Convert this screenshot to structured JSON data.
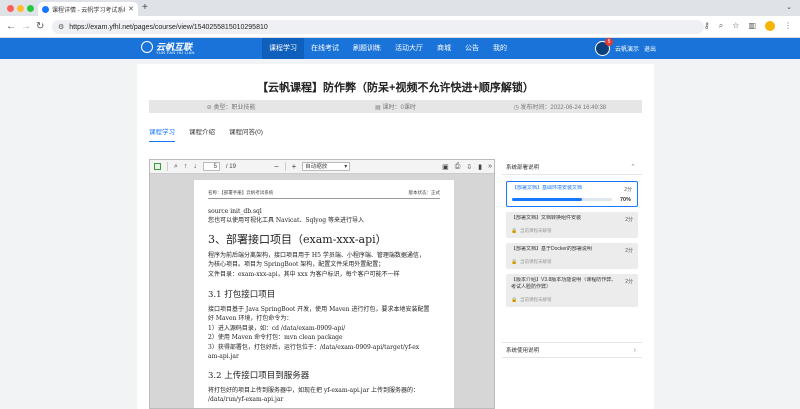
{
  "browser": {
    "tab_title": "课程详情 - 云帆学习考试系统",
    "url": "https://exam.yfhl.net/pages/course/view/1540255815010295810",
    "new_tab_icon": "plus-icon"
  },
  "site": {
    "logo_main": "云帆互联",
    "logo_sub": "YUN FAN HU LIAN",
    "nav": [
      "课程学习",
      "在线考试",
      "刷题训练",
      "活动大厅",
      "商城",
      "公告",
      "我的"
    ],
    "notification_count": "5",
    "user_name": "云帆演示",
    "logout": "退出",
    "brand_color": "#1a73d9"
  },
  "course": {
    "title": "【云帆课程】防作弊（防呆+视频不允许快进+顺序解锁）",
    "type": "类型：职业技能",
    "hours": "课时：0课时",
    "publish_time": "发布时间：2022-06-24 16:49:38",
    "tabs": [
      "课程学习",
      "课程介绍",
      "课程问答(0)"
    ]
  },
  "pdf": {
    "page": "5",
    "total": "/ 19",
    "zoom": "自动缩放",
    "header_left": "名称：【部署手册】云帆考试系统",
    "header_right": "版本状态：正式",
    "lines": [
      "source init_db.sql",
      "您也可以使用可视化工具 Navicat、Sqlyog 等来进行导入",
      "3、部署接口项目（exam-xxx-api）",
      "程序为前后端分离架构，接口项目用于 H5 学员端、小程序端、管理端数据通信，",
      "为核心项目。项目为 SpringBoot 架构，配置文件采用外置配置；",
      "文件目录：exam-xxx-api，其中 xxx 为客户标识，每个客户可能不一样",
      "3.1 打包接口项目",
      "接口项目基于 Java SpringBoot 开发，使用 Maven 进行打包，要求本地安装配置",
      "好 Maven 环境，打包命令为：",
      "1）进入源码目录，如：cd /data/exam-0909-api/",
      "2）使用 Maven 命令打包：mvn clean package",
      "3）获得部署包，打包好后，运行包位于：/data/exam-0909-api/target/yf-ex",
      "am-api.jar",
      "3.2 上传接口项目到服务器",
      "将打包好的项目上传到服务器中，如现在把 yf-exam-api.jar 上传到服务器的：",
      "/data/run/yf-exam-api.jar"
    ]
  },
  "side": {
    "section1": "系统部署说明",
    "section2": "系统使用说明",
    "lessons": [
      {
        "title": "【部署文档】基础环境安装文档",
        "duration": "2分",
        "progress": 0.7,
        "progress_label": "70%"
      },
      {
        "title": "【部署文档】文档转换组件安装",
        "duration": "2分",
        "status": "当前课程未解锁"
      },
      {
        "title": "【部署文档】基于Docker的部署说明",
        "duration": "2分",
        "status": "当前课程未解锁"
      },
      {
        "title": "【版本介绍】V3.8版本功能说明（课程防作弊、考试人脸防作弊）",
        "duration": "2分",
        "status": "当前课程未解锁"
      }
    ]
  }
}
